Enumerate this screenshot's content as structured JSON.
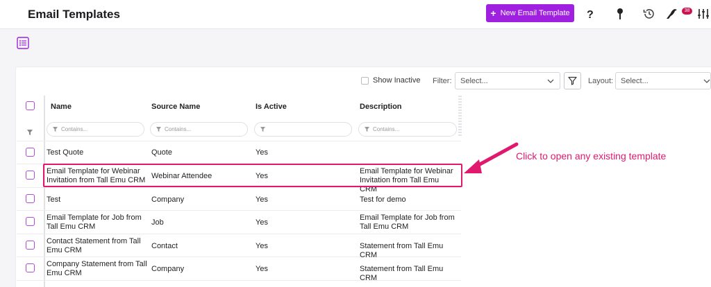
{
  "header": {
    "title": "Email Templates",
    "new_button_label": "New Email Template",
    "notification_count": "38"
  },
  "toolbar": {
    "show_inactive_label": "Show Inactive",
    "filter_label": "Filter:",
    "filter_value": "Select...",
    "layout_label": "Layout:",
    "layout_value": "Select..."
  },
  "table": {
    "columns": [
      "Name",
      "Source Name",
      "Is Active",
      "Description"
    ],
    "filter_placeholder": "Contains...",
    "rows": [
      {
        "name": "Test Quote",
        "source": "Quote",
        "active": "Yes",
        "description": ""
      },
      {
        "name": "Email Template for Webinar Invitation from Tall Emu CRM",
        "source": "Webinar Attendee",
        "active": "Yes",
        "description": "Email Template for Webinar Invitation from Tall Emu CRM"
      },
      {
        "name": "Test",
        "source": "Company",
        "active": "Yes",
        "description": "Test for demo"
      },
      {
        "name": "Email Template for Job from Tall Emu CRM",
        "source": "Job",
        "active": "Yes",
        "description": "Email Template for Job from Tall Emu CRM"
      },
      {
        "name": "Contact Statement from Tall Emu CRM",
        "source": "Contact",
        "active": "Yes",
        "description": "Statement from Tall Emu CRM"
      },
      {
        "name": "Company Statement from Tall Emu CRM",
        "source": "Company",
        "active": "Yes",
        "description": "Statement from Tall Emu CRM"
      }
    ]
  },
  "annotation": {
    "text": "Click to open any existing template"
  },
  "colors": {
    "accent": "#a020e0",
    "highlight": "#e0186e",
    "badge": "#d0104c"
  }
}
